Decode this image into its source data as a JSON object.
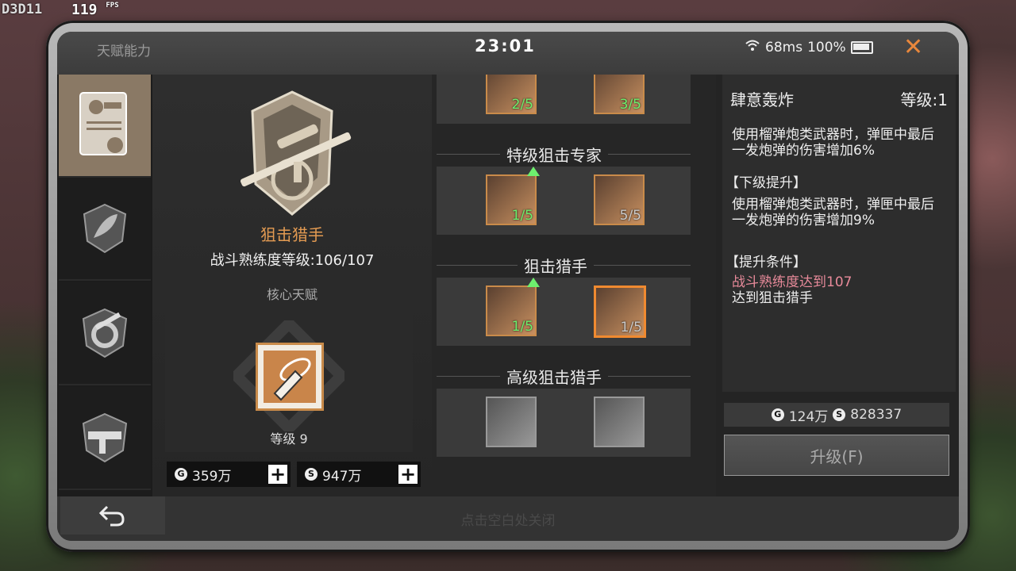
{
  "hud": {
    "id": "D3D11",
    "fps": "119",
    "fps_unit": "FPS"
  },
  "topbar": {
    "title": "天赋能力",
    "clock": "23:01",
    "ping": "68ms",
    "battery": "100%"
  },
  "sidebar": {
    "items": [
      "certificate-tab",
      "leaf-tab",
      "gear-hammer-tab",
      "smg-tab"
    ]
  },
  "profile": {
    "class_name": "狙击猎手",
    "proficiency": "战斗熟练度等级:106/107",
    "core_title": "核心天赋",
    "core_level": "等级 9"
  },
  "currency": {
    "left": "359万",
    "right": "947万"
  },
  "tree": {
    "tiers": [
      {
        "label": "特级狙击专家",
        "skills": [
          "1/5",
          "5/5"
        ]
      },
      {
        "label": "狙击猎手",
        "skills": [
          "1/5",
          "1/5"
        ]
      },
      {
        "label": "高级狙击猎手",
        "skills": [
          "",
          ""
        ]
      }
    ],
    "top_skills": [
      "2/5",
      "3/5"
    ]
  },
  "detail": {
    "name": "肆意轰炸",
    "level": "等级:1",
    "desc1": "使用榴弹炮类武器时，弹匣中最后一发炮弹的伤害增加6%",
    "next_head": "【下级提升】",
    "desc2": "使用榴弹炮类武器时，弹匣中最后一发炮弹的伤害增加9%",
    "cond_head": "【提升条件】",
    "cond1": "战斗熟练度达到107",
    "cond2": "达到狙击猎手",
    "cost_gold": "124万",
    "cost_silver": "828337",
    "upgrade": "升级(F)"
  },
  "bottom": {
    "hint": "点击空白处关闭"
  },
  "colors": {
    "accent": "#e29a52",
    "close": "#e8873c",
    "progress": "#6ef06e",
    "condition": "#e88a9a"
  }
}
